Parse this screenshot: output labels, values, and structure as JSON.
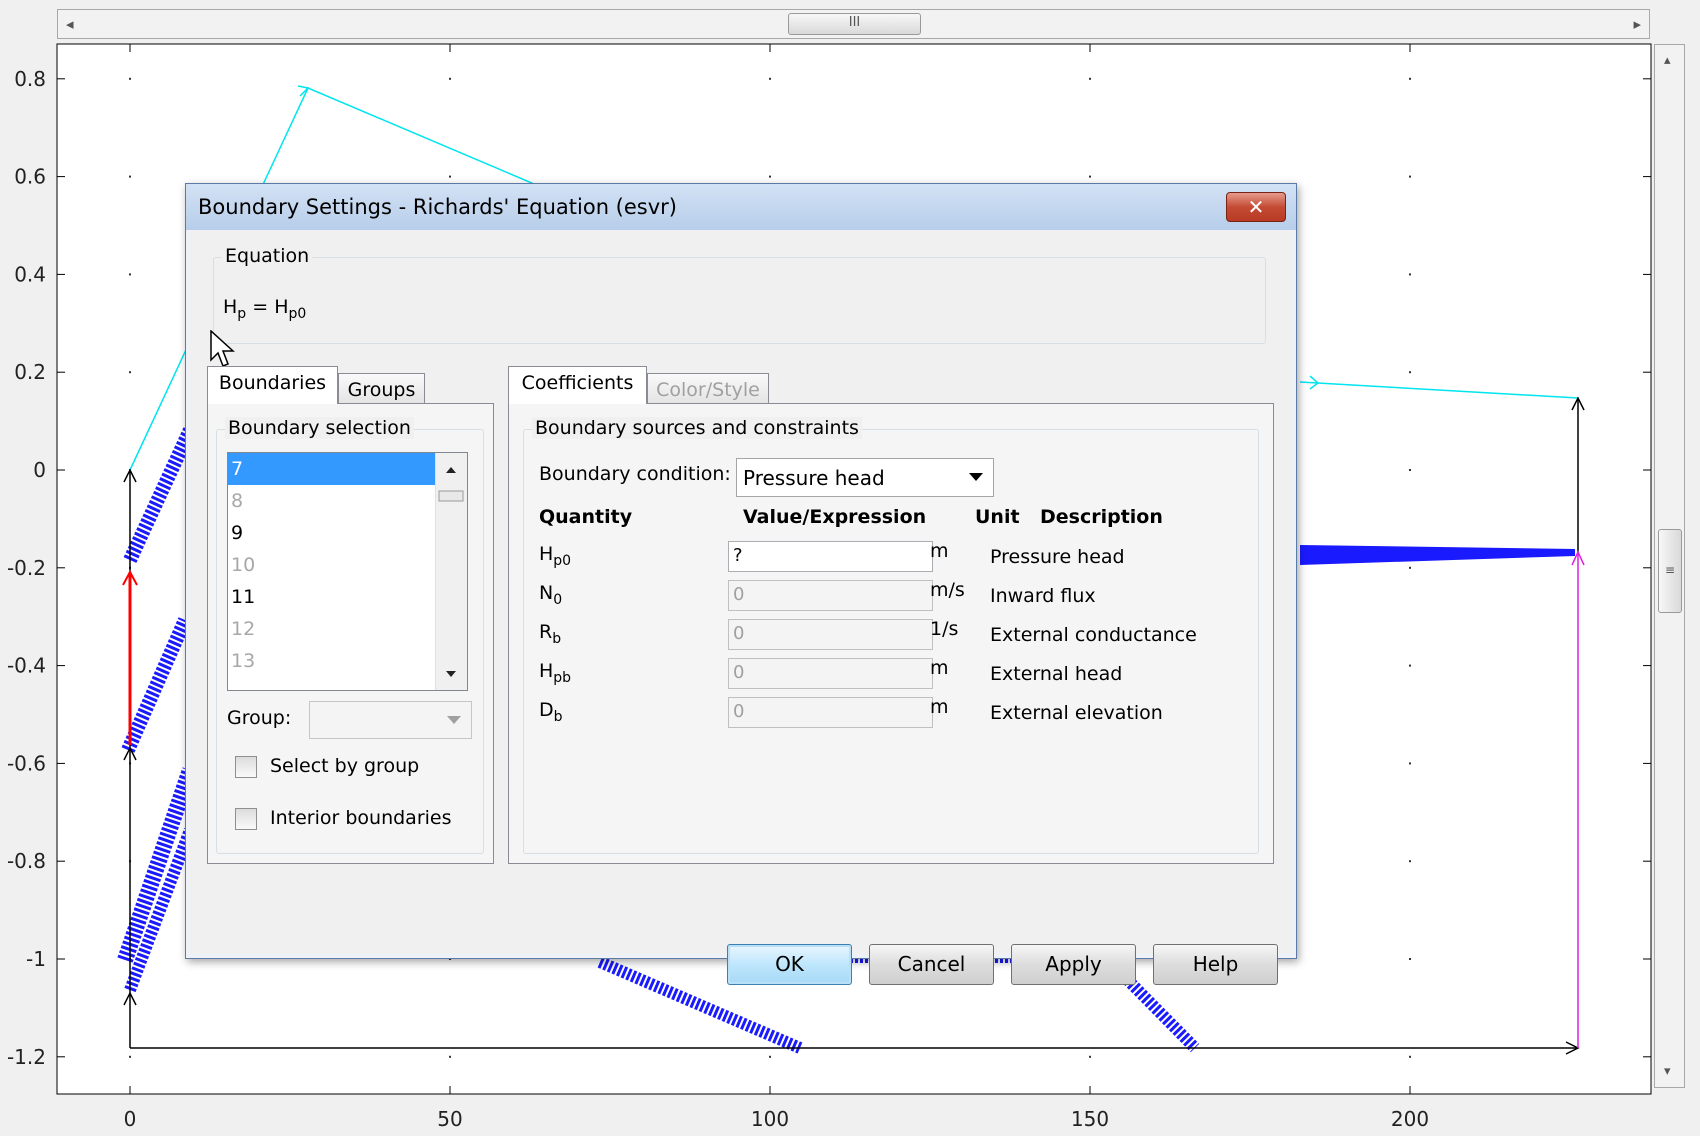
{
  "plot": {
    "y_ticks": [
      "0.8",
      "0.6",
      "0.4",
      "0.2",
      "0",
      "-0.2",
      "-0.4",
      "-0.6",
      "-0.8",
      "-1",
      "-1.2"
    ],
    "x_ticks": [
      "0",
      "50",
      "100",
      "150",
      "200"
    ],
    "colors": {
      "cyan": "#00e5ee",
      "blue": "#1a1aff",
      "red": "#ff0000",
      "magenta": "#e020e0",
      "black": "#000000"
    }
  },
  "hscroll": {
    "left_arrow": "◂",
    "right_arrow": "▸",
    "thumb_grip": "III"
  },
  "vscroll": {
    "up_arrow": "▴",
    "down_arrow": "▾",
    "thumb_grip": "≡"
  },
  "dialog": {
    "title": "Boundary Settings - Richards' Equation (esvr)",
    "close_label": "✕",
    "equation": {
      "legend": "Equation",
      "lhs": "H",
      "lhs_sub": "p",
      "equals": "=",
      "rhs": "H",
      "rhs_sub": "p0"
    },
    "left_tabs": [
      {
        "label": "Boundaries",
        "active": true
      },
      {
        "label": "Groups",
        "active": false
      }
    ],
    "boundary_selection": {
      "legend": "Boundary selection",
      "items": [
        {
          "label": "7",
          "state": "selected"
        },
        {
          "label": "8",
          "state": "dim"
        },
        {
          "label": "9",
          "state": "normal"
        },
        {
          "label": "10",
          "state": "dim"
        },
        {
          "label": "11",
          "state": "normal"
        },
        {
          "label": "12",
          "state": "dim"
        },
        {
          "label": "13",
          "state": "dim"
        }
      ],
      "group_label": "Group:",
      "group_value": "",
      "select_by_group": {
        "label": "Select by group",
        "checked": false
      },
      "interior_boundaries": {
        "label": "Interior boundaries",
        "checked": false
      }
    },
    "right_tabs": [
      {
        "label": "Coefficients",
        "active": true
      },
      {
        "label": "Color/Style",
        "active": false,
        "disabled": true
      }
    ],
    "sources": {
      "legend": "Boundary sources and constraints",
      "condition_label": "Boundary condition:",
      "condition_value": "Pressure head",
      "headers": {
        "quantity": "Quantity",
        "value": "Value/Expression",
        "unit": "Unit",
        "description": "Description"
      },
      "rows": [
        {
          "q": "H",
          "q_sub": "p0",
          "value": "?",
          "unit": "m",
          "desc": "Pressure head",
          "enabled": true
        },
        {
          "q": "N",
          "q_sub": "0",
          "value": "0",
          "unit": "m/s",
          "desc": "Inward flux",
          "enabled": false
        },
        {
          "q": "R",
          "q_sub": "b",
          "value": "0",
          "unit": "1/s",
          "desc": "External conductance",
          "enabled": false
        },
        {
          "q": "H",
          "q_sub": "pb",
          "value": "0",
          "unit": "m",
          "desc": "External head",
          "enabled": false
        },
        {
          "q": "D",
          "q_sub": "b",
          "value": "0",
          "unit": "m",
          "desc": "External elevation",
          "enabled": false
        }
      ]
    },
    "buttons": {
      "ok": "OK",
      "cancel": "Cancel",
      "apply": "Apply",
      "help": "Help"
    }
  }
}
